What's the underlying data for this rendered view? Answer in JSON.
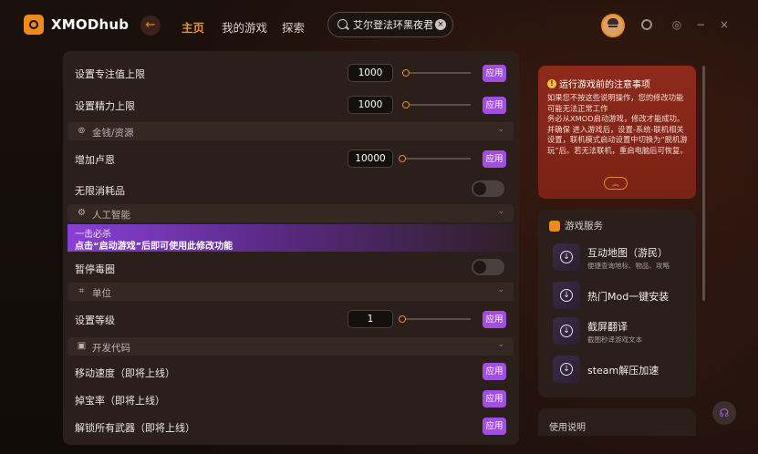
{
  "app": {
    "name": "XMODhub"
  },
  "nav": {
    "home": "主页",
    "my_games": "我的游戏",
    "explore": "探索"
  },
  "search": {
    "value": "艾尔登法环黑夜君临",
    "clear": "×"
  },
  "settings": {
    "focus_label": "设置专注值上限",
    "focus_value": "1000",
    "stamina_label": "设置精力上限",
    "stamina_value": "1000",
    "money_section": "金钱/资源",
    "money_add_label": "增加卢恩",
    "money_add_value": "10000",
    "unlimited_label": "无限消耗品",
    "ai_section": "人工智能",
    "banner_line1": "一击必杀",
    "banner_line2": "点击“启动游戏”后即可使用此修改功能",
    "pause_poison_label": "暂停毒圈",
    "unit_section": "单位",
    "level_label": "设置等级",
    "level_value": "1",
    "dev_section": "开发代码",
    "move_speed_label": "移动速度（即将上线）",
    "drop_rate_label": "掉宝率（即将上线）",
    "unlock_weapons_label": "解锁所有武器（即将上线）",
    "apply": "应用"
  },
  "notice": {
    "title": "运行游戏前的注意事项",
    "body": "如果您不按这些说明操作，您的修改功能可能无法正常工作\n务必从XMOD启动游戏，修改才能成功。\n并确保 进入游戏后，设置-系统-联机相关设置，联机模式启动设置中切换为“脱机游玩”后。若无法联机，重启电脑后可恢复。",
    "expand": "︽"
  },
  "services": {
    "title": "游戏服务",
    "items": [
      {
        "title": "互动地图（游民）",
        "sub": "便捷查询地标、物品、攻略"
      },
      {
        "title": "热门Mod一键安装",
        "sub": ""
      },
      {
        "title": "截屏翻译",
        "sub": "截图秒译游戏文本"
      },
      {
        "title": "steam解压加速",
        "sub": ""
      }
    ]
  },
  "usage": {
    "title": "使用说明"
  },
  "icons": {
    "back": "arrow-left-icon",
    "search": "search-icon",
    "headset": "headset-icon"
  },
  "colors": {
    "accent": "#f08a1c",
    "apply": "#a24ee0",
    "notice": "#8e2a1a"
  }
}
